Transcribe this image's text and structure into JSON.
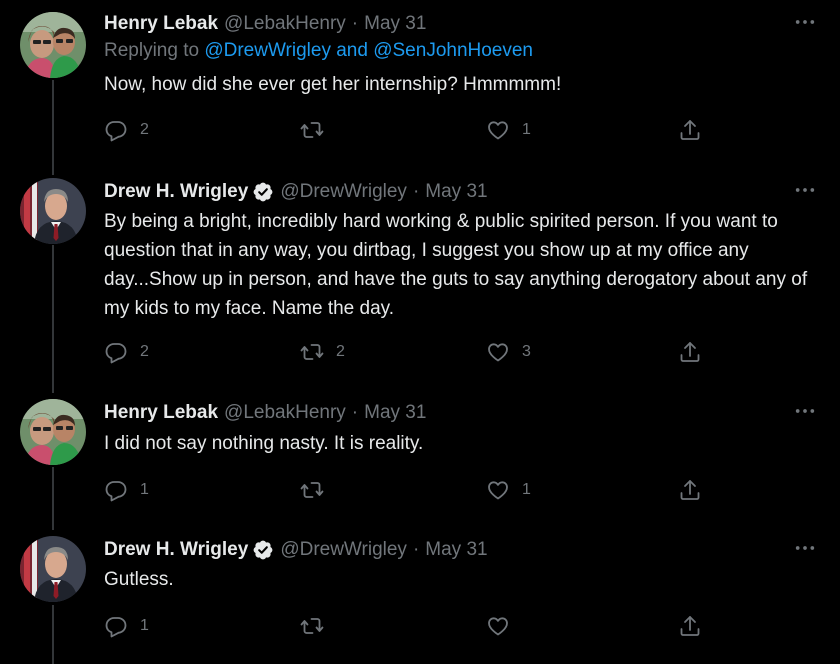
{
  "tweets": [
    {
      "name": "Henry Lebak",
      "handle": "@LebakHenry",
      "date": "May 31",
      "verified": false,
      "reply_prefix": "Replying to",
      "reply_mentions": "@DrewWrigley and @SenJohnHoeven",
      "text": "Now, how did she ever get her internship?  Hmmmmm!",
      "replies": "2",
      "retweets": "",
      "likes": "1"
    },
    {
      "name": "Drew H. Wrigley",
      "handle": "@DrewWrigley",
      "date": "May 31",
      "verified": true,
      "text": "By being a bright, incredibly hard working & public spirited person. If you want to question that in any way, you dirtbag, I suggest you show up at my office any day...Show up in person, and have the guts to say anything derogatory about any of my kids to my face. Name the day.",
      "replies": "2",
      "retweets": "2",
      "likes": "3"
    },
    {
      "name": "Henry Lebak",
      "handle": "@LebakHenry",
      "date": "May 31",
      "verified": false,
      "text": "I did not say nothing nasty. It is reality.",
      "replies": "1",
      "retweets": "",
      "likes": "1"
    },
    {
      "name": "Drew H. Wrigley",
      "handle": "@DrewWrigley",
      "date": "May 31",
      "verified": true,
      "text": "Gutless.",
      "replies": "1",
      "retweets": "",
      "likes": ""
    }
  ],
  "separator": "·",
  "icons": {
    "reply": "reply-icon",
    "retweet": "retweet-icon",
    "like": "heart-icon",
    "share": "share-icon",
    "more": "more-icon",
    "verified": "verified-badge-icon"
  },
  "colors": {
    "background": "#000000",
    "text": "#e7e9ea",
    "secondary": "#71767b",
    "link": "#1d9bf0"
  }
}
